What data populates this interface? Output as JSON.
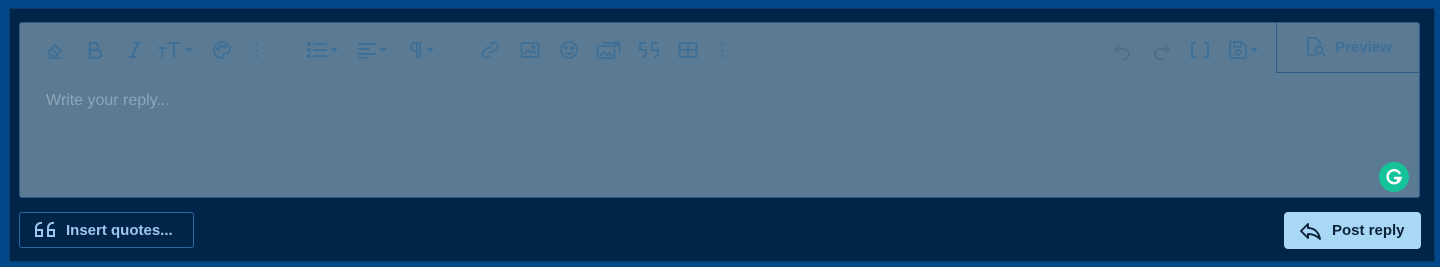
{
  "editor": {
    "placeholder": "Write your reply...",
    "toolbar": {
      "left": [
        {
          "icon": "eraser-icon",
          "label": "Remove formatting"
        },
        {
          "icon": "bold-icon",
          "label": "Bold"
        },
        {
          "icon": "italic-icon",
          "label": "Italic"
        },
        {
          "icon": "text-size-icon",
          "label": "Font size"
        },
        {
          "icon": "palette-icon",
          "label": "Text color"
        },
        {
          "icon": "more-options-icon",
          "label": "More options"
        },
        {
          "icon": "list-icon",
          "label": "List"
        },
        {
          "icon": "align-icon",
          "label": "Alignment"
        },
        {
          "icon": "paragraph-icon",
          "label": "Paragraph format"
        },
        {
          "icon": "link-icon",
          "label": "Insert link"
        },
        {
          "icon": "image-icon",
          "label": "Insert image"
        },
        {
          "icon": "smiley-icon",
          "label": "Smilies"
        },
        {
          "icon": "media-icon",
          "label": "Insert media"
        },
        {
          "icon": "quote-icon",
          "label": "Quote"
        },
        {
          "icon": "table-icon",
          "label": "Insert table"
        },
        {
          "icon": "more-options-icon",
          "label": "More options"
        }
      ],
      "right": [
        {
          "icon": "undo-icon"
        },
        {
          "icon": "redo-icon"
        },
        {
          "icon": "bbcode-toggle-icon"
        },
        {
          "icon": "save-draft-icon"
        }
      ],
      "preview_label": "Preview"
    }
  },
  "actions": {
    "insert_quotes_label": "Insert quotes...",
    "post_reply_label": "Post reply"
  },
  "colors": {
    "page_bg": "#00488a",
    "panel_bg": "#002548",
    "editor_bg": "#5b7a93",
    "toolbar_icon": "#3e6f97",
    "post_button_bg": "#a9d8f7",
    "grammarly": "#15c39a"
  }
}
